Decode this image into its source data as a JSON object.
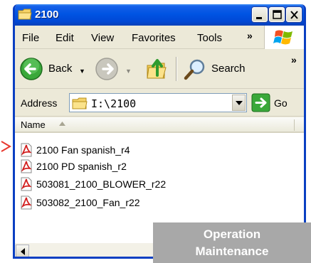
{
  "window": {
    "title": "2100"
  },
  "menubar": {
    "items": [
      "File",
      "Edit",
      "View",
      "Favorites",
      "Tools"
    ],
    "more": "»"
  },
  "toolbar": {
    "back_label": "Back",
    "search_label": "Search",
    "more": "»"
  },
  "address": {
    "label": "Address",
    "value": "I:\\2100",
    "go_label": "Go"
  },
  "filelist": {
    "column_header": "Name",
    "files": [
      {
        "name": "2100 Fan spanish_r4",
        "icon": "pdf-file-icon"
      },
      {
        "name": "2100 PD spanish_r2",
        "icon": "pdf-file-icon"
      },
      {
        "name": "503081_2100_BLOWER_r22",
        "icon": "pdf-file-icon"
      },
      {
        "name": "503082_2100_Fan_r22",
        "icon": "pdf-file-icon"
      }
    ]
  },
  "overlay": {
    "line1": "Operation",
    "line2": "Maintenance"
  },
  "colors": {
    "titlebar": "#0054e3",
    "chrome": "#ece9d8",
    "overlay": "#a8a8a8",
    "marker": "#e8382f"
  }
}
